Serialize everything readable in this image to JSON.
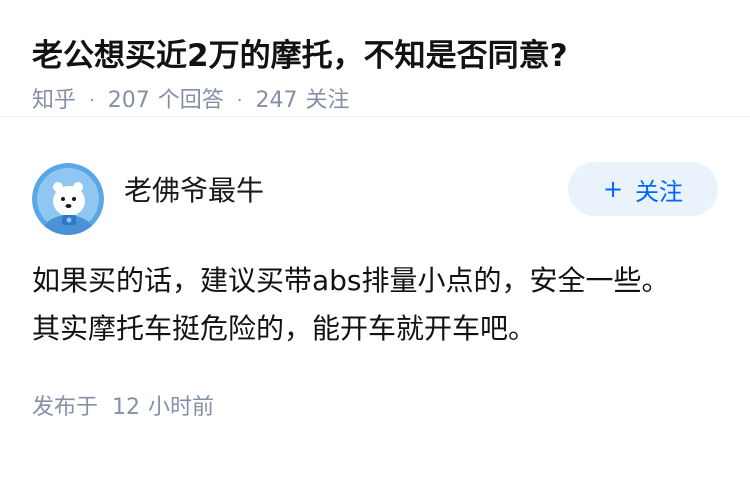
{
  "question": {
    "title": "老公想买近2万的摩托，不知是否同意?",
    "source": "知乎",
    "answer_count": "207",
    "answer_label": "个回答",
    "follow_count": "247",
    "follow_label": "关注"
  },
  "answer": {
    "author_name": "老佛爷最牛",
    "follow_button_label": "关注",
    "content": "如果买的话，建议买带abs排量小点的，安全一些。\n其实摩托车挺危险的，能开车就开车吧。",
    "published_prefix": "发布于",
    "published_num": "12",
    "published_suffix": "小时前"
  },
  "colors": {
    "accent": "#0066ff",
    "meta_gray": "#8590a6",
    "follow_bg": "#eaf2fb"
  }
}
